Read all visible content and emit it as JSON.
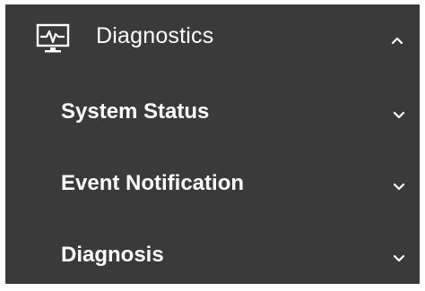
{
  "menu": {
    "header": {
      "title": "Diagnostics",
      "icon": "monitor-pulse-icon",
      "chevron_icon": "chevron-up-icon"
    },
    "items": [
      {
        "label": "System Status",
        "chevron_icon": "chevron-down-icon"
      },
      {
        "label": "Event Notification",
        "chevron_icon": "chevron-down-icon"
      },
      {
        "label": "Diagnosis",
        "chevron_icon": "chevron-down-icon"
      }
    ],
    "colors": {
      "background": "#3a3a3a",
      "text": "#ffffff",
      "page": "#ffffff"
    }
  }
}
